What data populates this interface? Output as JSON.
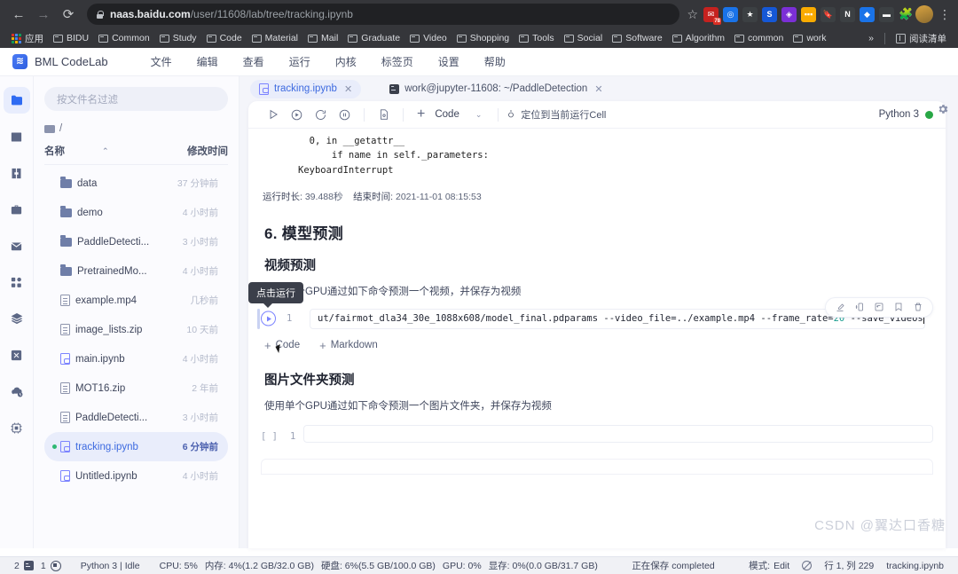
{
  "browser": {
    "nav": {
      "back": "←",
      "forward": "→",
      "reload": "⟳"
    },
    "url_domain": "naas.baidu.com",
    "url_path": "/user/11608/lab/tree/tracking.ipynb",
    "star": "☆",
    "extensions": [
      {
        "name": "mail-extension",
        "glyph": "✉",
        "color": "#c5221f",
        "badge": "78"
      },
      {
        "name": "circle-extension",
        "glyph": "◎",
        "color": "#1a73e8",
        "badge": ""
      },
      {
        "name": "star-extension",
        "glyph": "★",
        "color": "#3c4043",
        "badge": ""
      },
      {
        "name": "s-extension",
        "glyph": "S",
        "color": "#1558d6",
        "badge": ""
      },
      {
        "name": "box-extension",
        "glyph": "◈",
        "color": "#7b2fd6",
        "badge": ""
      },
      {
        "name": "dots-extension",
        "glyph": "▪▪▪",
        "color": "#f9ab00",
        "badge": ""
      },
      {
        "name": "bookmark-extension",
        "glyph": "🔖",
        "color": "#3c4043",
        "badge": ""
      },
      {
        "name": "notion-extension",
        "glyph": "N",
        "color": "#3c4043",
        "badge": ""
      },
      {
        "name": "gem-extension",
        "glyph": "◆",
        "color": "#1a73e8",
        "badge": ""
      },
      {
        "name": "mask-extension",
        "glyph": "▬",
        "color": "#3c4043",
        "badge": ""
      }
    ],
    "puzzle": "🧩",
    "menu": "⋮",
    "bookmarks": [
      {
        "label": "应用",
        "icon": "apps-grid-icon"
      },
      {
        "label": "BIDU",
        "icon": "folder-icon"
      },
      {
        "label": "Common",
        "icon": "folder-icon"
      },
      {
        "label": "Study",
        "icon": "folder-icon"
      },
      {
        "label": "Code",
        "icon": "folder-icon"
      },
      {
        "label": "Material",
        "icon": "folder-icon"
      },
      {
        "label": "Mail",
        "icon": "folder-icon"
      },
      {
        "label": "Graduate",
        "icon": "folder-icon"
      },
      {
        "label": "Video",
        "icon": "folder-icon"
      },
      {
        "label": "Shopping",
        "icon": "folder-icon"
      },
      {
        "label": "Tools",
        "icon": "folder-icon"
      },
      {
        "label": "Social",
        "icon": "folder-icon"
      },
      {
        "label": "Software",
        "icon": "folder-icon"
      },
      {
        "label": "Algorithm",
        "icon": "folder-icon"
      },
      {
        "label": "common",
        "icon": "folder-icon"
      },
      {
        "label": "work",
        "icon": "folder-icon"
      }
    ],
    "overflow": "»",
    "reading_list": "阅读清单"
  },
  "app": {
    "brand": "BML CodeLab",
    "menus": [
      "文件",
      "编辑",
      "查看",
      "运行",
      "内核",
      "标签页",
      "设置",
      "帮助"
    ]
  },
  "rail": [
    {
      "name": "file-browser-icon",
      "active": true
    },
    {
      "name": "running-terminals-icon",
      "active": false
    },
    {
      "name": "extensions-icon",
      "active": false
    },
    {
      "name": "toolbox-icon",
      "active": false
    },
    {
      "name": "mail-icon",
      "active": false
    },
    {
      "name": "apps-icon",
      "active": false
    },
    {
      "name": "layers-icon",
      "active": false
    },
    {
      "name": "dataset-icon",
      "active": false
    },
    {
      "name": "cloud-sync-icon",
      "active": false
    },
    {
      "name": "chip-icon",
      "active": false
    }
  ],
  "filebrowser": {
    "filter_placeholder": "按文件名过滤",
    "breadcrumb": "/",
    "columns": {
      "name": "名称",
      "modified": "修改时间",
      "sort_caret": "⌃"
    },
    "files": [
      {
        "name": "data",
        "modified": "37 分钟前",
        "type": "folder",
        "selected": false,
        "running": false
      },
      {
        "name": "demo",
        "modified": "4 小时前",
        "type": "folder",
        "selected": false,
        "running": false
      },
      {
        "name": "PaddleDetecti...",
        "modified": "3 小时前",
        "type": "folder",
        "selected": false,
        "running": false
      },
      {
        "name": "PretrainedMo...",
        "modified": "4 小时前",
        "type": "folder",
        "selected": false,
        "running": false
      },
      {
        "name": "example.mp4",
        "modified": "几秒前",
        "type": "file",
        "selected": false,
        "running": false
      },
      {
        "name": "image_lists.zip",
        "modified": "10 天前",
        "type": "file",
        "selected": false,
        "running": false
      },
      {
        "name": "main.ipynb",
        "modified": "4 小时前",
        "type": "notebook",
        "selected": false,
        "running": false
      },
      {
        "name": "MOT16.zip",
        "modified": "2 年前",
        "type": "file",
        "selected": false,
        "running": false
      },
      {
        "name": "PaddleDetecti...",
        "modified": "3 小时前",
        "type": "file",
        "selected": false,
        "running": false
      },
      {
        "name": "tracking.ipynb",
        "modified": "6 分钟前",
        "type": "notebook",
        "selected": true,
        "running": true
      },
      {
        "name": "Untitled.ipynb",
        "modified": "4 小时前",
        "type": "notebook",
        "selected": false,
        "running": false
      }
    ]
  },
  "tabs": [
    {
      "label": "tracking.ipynb",
      "icon": "notebook-icon",
      "active": true,
      "close": "✕"
    },
    {
      "label": "work@jupyter-11608: ~/PaddleDetection",
      "icon": "terminal-icon",
      "active": false,
      "close": "✕"
    }
  ],
  "notebook_toolbar": {
    "buttons": [
      {
        "name": "run-button",
        "title": "运行"
      },
      {
        "name": "run-all-button",
        "title": "运行全部"
      },
      {
        "name": "restart-kernel-button",
        "title": "重启内核"
      },
      {
        "name": "interrupt-kernel-button",
        "title": "中断内核"
      },
      {
        "name": "save-button",
        "title": "保存"
      }
    ],
    "add_cell": "+",
    "cell_type": "Code",
    "caret": "⌄",
    "locate_label": "定位到当前运行Cell",
    "kernel_name": "Python 3",
    "kernel_status_color": "#28a745"
  },
  "notebook": {
    "error_output": "  0, in __getattr__\n      if name in self._parameters:\nKeyboardInterrupt",
    "run_duration_label": "运行时长:",
    "run_duration_value": "39.488秒",
    "end_time_label": "结束时间:",
    "end_time_value": "2021-11-01 08:15:53",
    "heading1": "6. 模型预测",
    "heading2": "视频预测",
    "paragraph1": "使用单个GPU通过如下命令预测一个视频，并保存为视频",
    "tooltip": "点击运行",
    "cell_number": "1",
    "cell_code_head": "ut/fairmot_dla34_30e_1088x608/model_final.pdparams --video_file=../example.mp4 --frame_rate=",
    "cell_code_number": "20",
    "cell_code_tail": " --save_videos",
    "cell_tools": [
      {
        "name": "duplicate-cell-icon",
        "glyph": "⎘"
      },
      {
        "name": "move-cell-icon",
        "glyph": "⇥"
      },
      {
        "name": "paste-cell-icon",
        "glyph": "⎗"
      },
      {
        "name": "bookmark-cell-icon",
        "glyph": "🔖"
      },
      {
        "name": "delete-cell-icon",
        "glyph": "🗑"
      }
    ],
    "add_code": "Code",
    "add_markdown": "Markdown",
    "add_plus": "+",
    "heading3": "图片文件夹预测",
    "paragraph2": "使用单个GPU通过如下命令预测一个图片文件夹，并保存为视频",
    "empty_cell_prompt": "[ ]",
    "empty_cell_number": "1"
  },
  "statusbar": {
    "terminals_count": "2",
    "kernels_count": "1",
    "kernel_info": "Python 3 | Idle",
    "cpu": "CPU: 5%",
    "memory": "内存: 4%(1.2 GB/32.0 GB)",
    "disk": "硬盘: 6%(5.5 GB/100.0 GB)",
    "gpu": "GPU: 0%",
    "vram": "显存: 0%(0.0 GB/31.7 GB)",
    "save_status": "正在保存 completed",
    "mode_label": "模式:",
    "mode_value": "Edit",
    "cursor": "行 1, 列 229",
    "filename": "tracking.ipynb"
  },
  "watermark": "CSDN @翼达口香糖"
}
